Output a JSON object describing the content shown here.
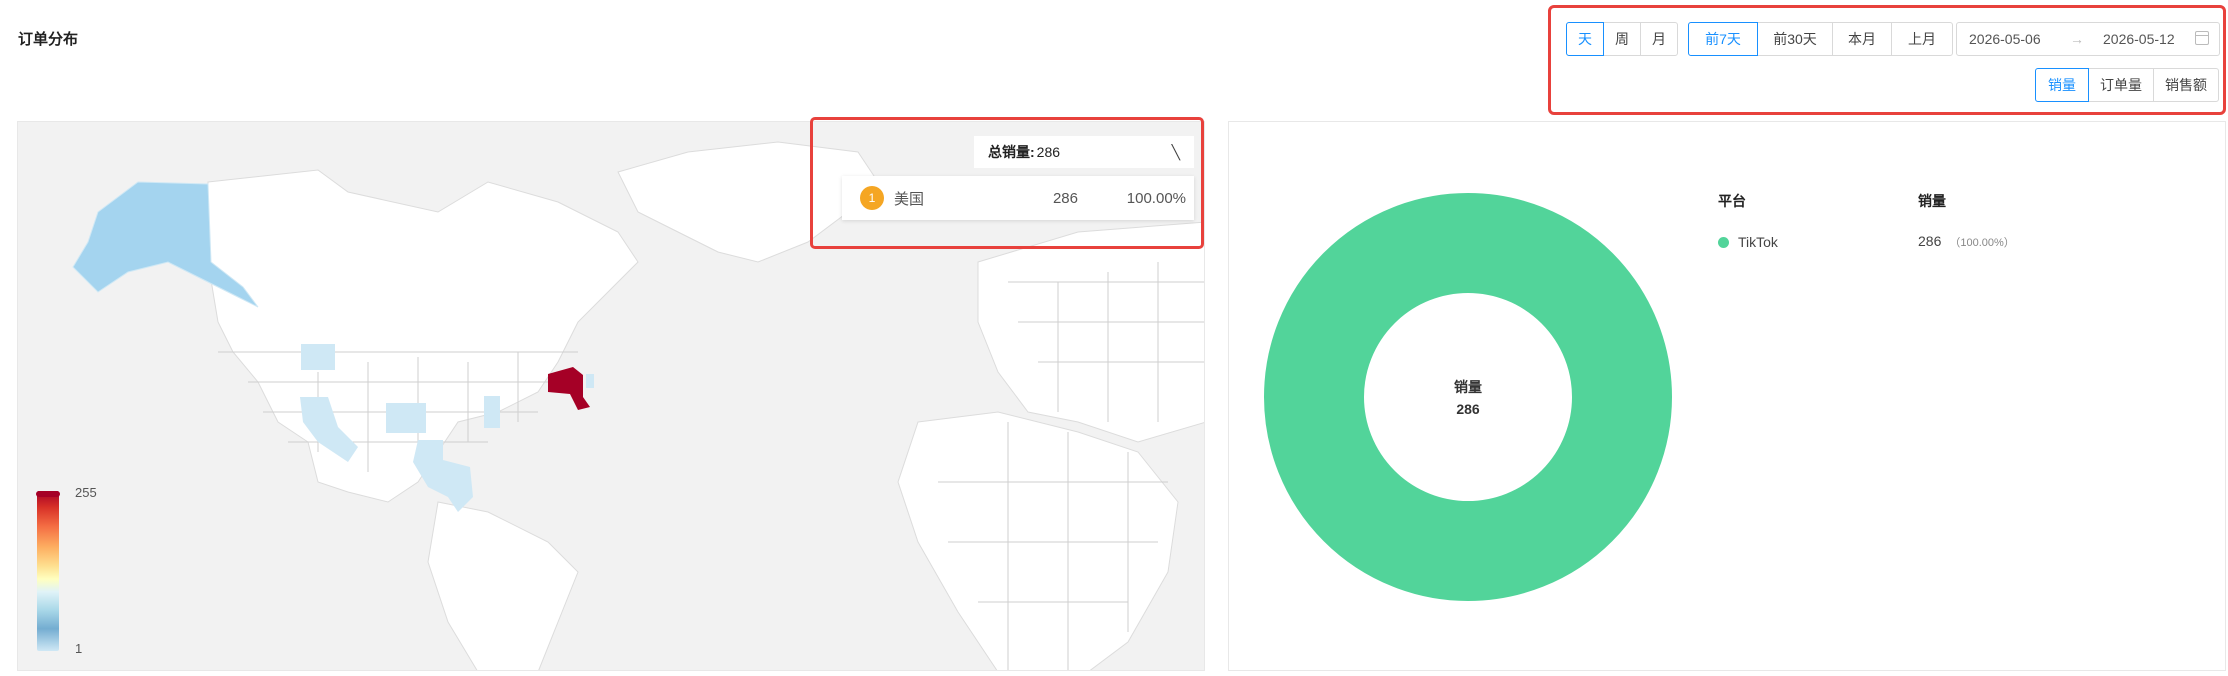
{
  "page": {
    "title": "订单分布"
  },
  "granularity": {
    "options": [
      "天",
      "周",
      "月"
    ],
    "active": 0
  },
  "periods": {
    "options": [
      "前7天",
      "前30天",
      "本月",
      "上月"
    ],
    "active": 0
  },
  "date_range": {
    "start": "2026-05-06",
    "end": "2026-05-12",
    "separator": "→"
  },
  "metrics": {
    "options": [
      "销量",
      "订单量",
      "销售额"
    ],
    "active": 0
  },
  "map": {
    "tooltip": {
      "label": "总销量:",
      "value": "286",
      "collapse_icon": "chevron-icon"
    },
    "ranking": [
      {
        "rank": "1",
        "country": "美国",
        "value": "286",
        "percent": "100.00%"
      }
    ],
    "legend": {
      "max": "255",
      "min": "1"
    },
    "colors": {
      "highest": "#a50026",
      "low": "#cfe8f5",
      "land": "#ffffff",
      "ocean": "#f2f2f2"
    }
  },
  "pie": {
    "center_label": "销量",
    "center_value": "286",
    "headers": {
      "platform": "平台",
      "value": "销量"
    },
    "items": [
      {
        "name": "TikTok",
        "value": "286",
        "percent": "（100.00%）",
        "color": "#52d49a"
      }
    ]
  },
  "chart_data": {
    "type": "pie",
    "categories": [
      "TikTok"
    ],
    "values": [
      286
    ],
    "donut": true
  }
}
